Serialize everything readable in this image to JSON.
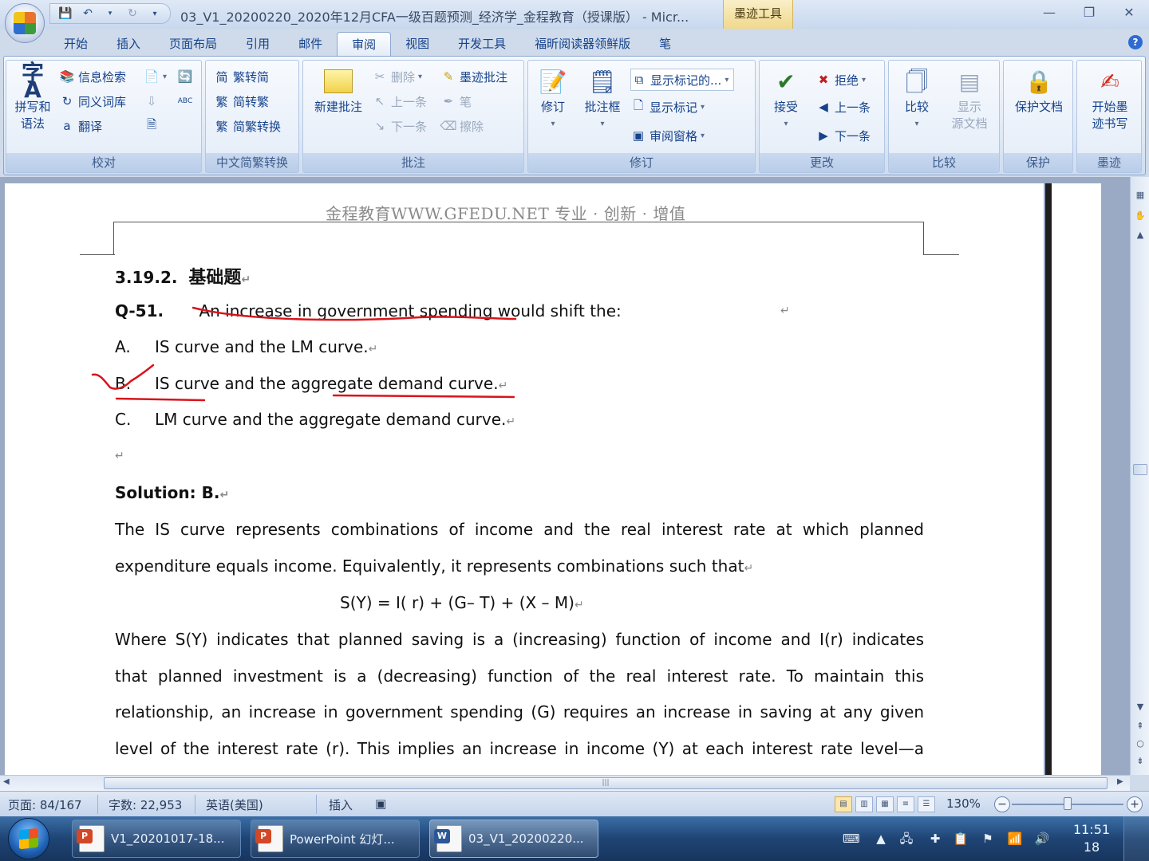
{
  "window": {
    "title": "03_V1_20200220_2020年12月CFA一级百题预测_经济学_金程教育（授课版） - Micr...",
    "contextual_tab": "墨迹工具",
    "controls": [
      "—",
      "❐",
      "✕"
    ]
  },
  "ribbon_tabs": [
    "开始",
    "插入",
    "页面布局",
    "引用",
    "邮件",
    "审阅",
    "视图",
    "开发工具",
    "福昕阅读器领鲜版",
    "笔"
  ],
  "active_tab": "审阅",
  "ribbon": {
    "proofing": {
      "label": "校对",
      "spell_check": "拼写和",
      "spell_check_2": "语法",
      "research": "信息检索",
      "thesaurus": "同义词库",
      "translate": "翻译"
    },
    "chinese_conversion": {
      "label": "中文简繁转换",
      "trad_to_simp": "繁转简",
      "simp_to_trad": "简转繁",
      "convert": "简繁转换"
    },
    "comments": {
      "label": "批注",
      "new_comment": "新建批注",
      "delete": "删除",
      "previous": "上一条",
      "next": "下一条",
      "ink_comment": "墨迹批注",
      "pen": "笔",
      "eraser": "擦除"
    },
    "tracking": {
      "label": "修订",
      "track_changes": "修订",
      "balloons": "批注框",
      "display": "显示标记的...",
      "show_markup": "显示标记",
      "reviewing_pane": "审阅窗格"
    },
    "changes": {
      "label": "更改",
      "accept": "接受",
      "reject": "拒绝",
      "previous": "上一条",
      "next": "下一条"
    },
    "compare": {
      "label": "比较",
      "compare": "比较",
      "show_source": "显示",
      "show_source_2": "源文档"
    },
    "protect": {
      "label": "保护",
      "protect_document": "保护文档"
    },
    "ink": {
      "label": "墨迹",
      "start_inking": "开始墨",
      "start_inking_2": "迹书写"
    }
  },
  "document": {
    "header": "金程教育WWW.GFEDU.NET     专业 · 创新 · 增值",
    "section_number": "3.19.2.",
    "section_title": "基础题",
    "question_id": "Q-51.",
    "question_text": "An increase in government spending  would shift the:",
    "options": [
      {
        "letter": "A.",
        "text": "IS curve and the LM curve."
      },
      {
        "letter": "B.",
        "text": "IS curve and the aggregate demand curve."
      },
      {
        "letter": "C.",
        "text": "LM curve and the aggregate demand curve."
      }
    ],
    "solution_label": "Solution: B.",
    "paragraphs": [
      "The IS curve represents combinations of income and the real interest rate at which planned",
      "expenditure equals income. Equivalently, it represents combinations such that",
      "S(Y) = I( r) + (G– T) + (X – M)",
      "Where S(Y) indicates that planned saving is a (increasing) function of income and I(r) indicates",
      "that planned investment is a (decreasing) function of the real interest rate. To maintain this",
      "relationship, an increase in government spending (G) requires an increase in saving at any given",
      "level of the interest rate (r). This implies an increase in income (Y) at each interest rate level—a"
    ],
    "ink_color": "#d9141b"
  },
  "status": {
    "page": "页面: 84/167",
    "words": "字数: 22,953",
    "language": "英语(美国)",
    "mode": "插入",
    "zoom": "130%",
    "zoom_level": 0.5
  },
  "taskbar": {
    "tasks": [
      {
        "label": "V1_20201017-18...",
        "badge": "P",
        "color": "#d24726"
      },
      {
        "label": "PowerPoint 幻灯...",
        "badge": "P",
        "color": "#d24726"
      },
      {
        "label": "03_V1_20200220...",
        "badge": "W",
        "color": "#2b5797"
      }
    ],
    "time": "11:51",
    "date": "18"
  }
}
